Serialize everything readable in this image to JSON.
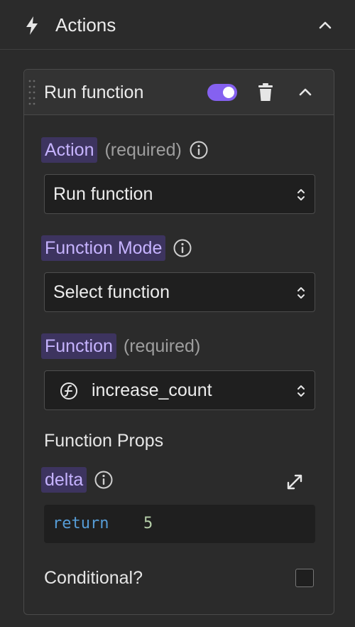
{
  "section": {
    "title": "Actions",
    "icon": "lightning-bolt-icon"
  },
  "action_card": {
    "title": "Run function",
    "enabled": true,
    "accent_color": "#8561f0"
  },
  "fields": {
    "action": {
      "label": "Action",
      "hint": "(required)",
      "value": "Run function"
    },
    "function_mode": {
      "label": "Function Mode",
      "value": "Select function"
    },
    "function": {
      "label": "Function",
      "hint": "(required)",
      "value": "increase_count",
      "icon": "function-icon"
    },
    "function_props": {
      "heading": "Function Props"
    },
    "delta": {
      "label": "delta",
      "code_keyword": "return",
      "code_value": "5"
    },
    "conditional": {
      "label": "Conditional?",
      "checked": false
    }
  }
}
